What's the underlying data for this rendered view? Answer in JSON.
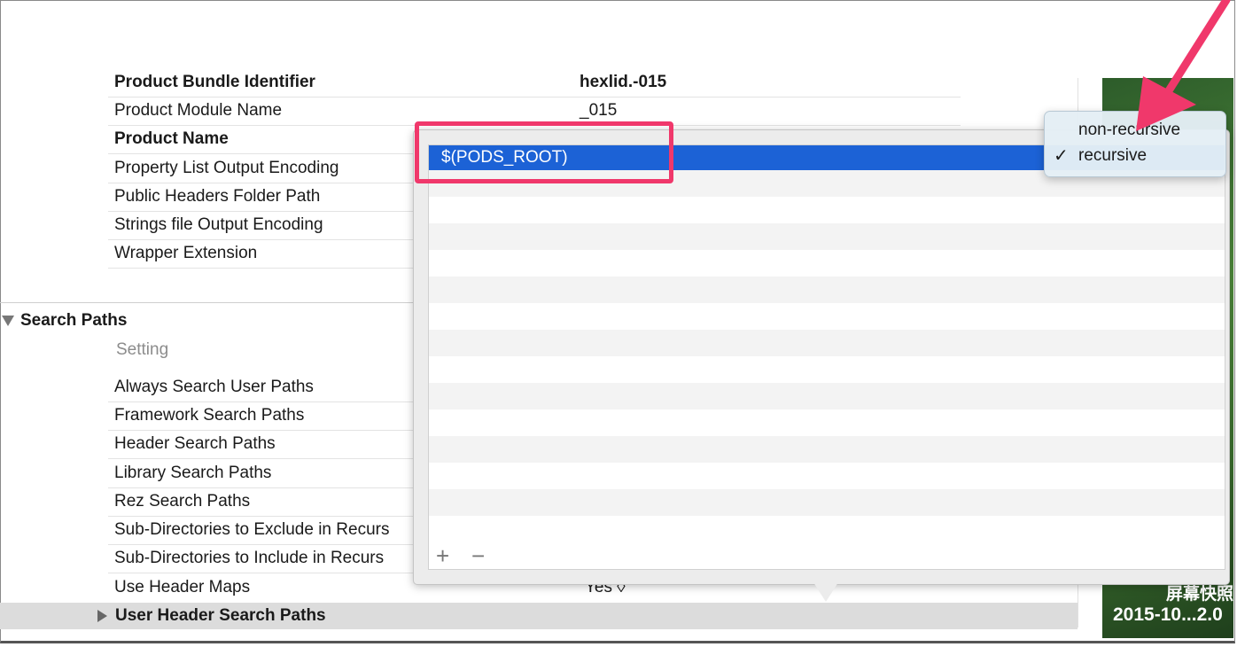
{
  "build_settings": {
    "top_rows": [
      {
        "label": "Product Bundle Identifier",
        "value": "hexlid.-015",
        "bold": true
      },
      {
        "label": "Product Module Name",
        "value": "_015",
        "bold": false
      },
      {
        "label": "Product Name",
        "value": "",
        "bold": true
      },
      {
        "label": "Property List Output Encoding",
        "value": "",
        "bold": false
      },
      {
        "label": "Public Headers Folder Path",
        "value": "",
        "bold": false
      },
      {
        "label": "Strings file Output Encoding",
        "value": "",
        "bold": false
      },
      {
        "label": "Wrapper Extension",
        "value": "",
        "bold": false
      }
    ],
    "section_title": "Search Paths",
    "column_header": "Setting",
    "search_rows": [
      {
        "label": "Always Search User Paths"
      },
      {
        "label": "Framework Search Paths"
      },
      {
        "label": "Header Search Paths"
      },
      {
        "label": "Library Search Paths"
      },
      {
        "label": "Rez Search Paths"
      },
      {
        "label": "Sub-Directories to Exclude in Recurs"
      },
      {
        "label": "Sub-Directories to Include in Recurs"
      },
      {
        "label": "Use Header Maps",
        "value": "Yes ◊"
      }
    ],
    "highlighted_row": "User Header Search Paths"
  },
  "popover": {
    "selected_path": "$(PODS_ROOT)",
    "add_label": "+",
    "remove_label": "−"
  },
  "recursion_menu": {
    "options": [
      "non-recursive",
      "recursive"
    ],
    "selected": "recursive",
    "check": "✓"
  },
  "thumbnail": {
    "caption_line1": "屏幕快照",
    "caption_line2": "2015-10...2.0"
  },
  "colors": {
    "selection": "#1c62d6",
    "annotation": "#f0386b"
  }
}
